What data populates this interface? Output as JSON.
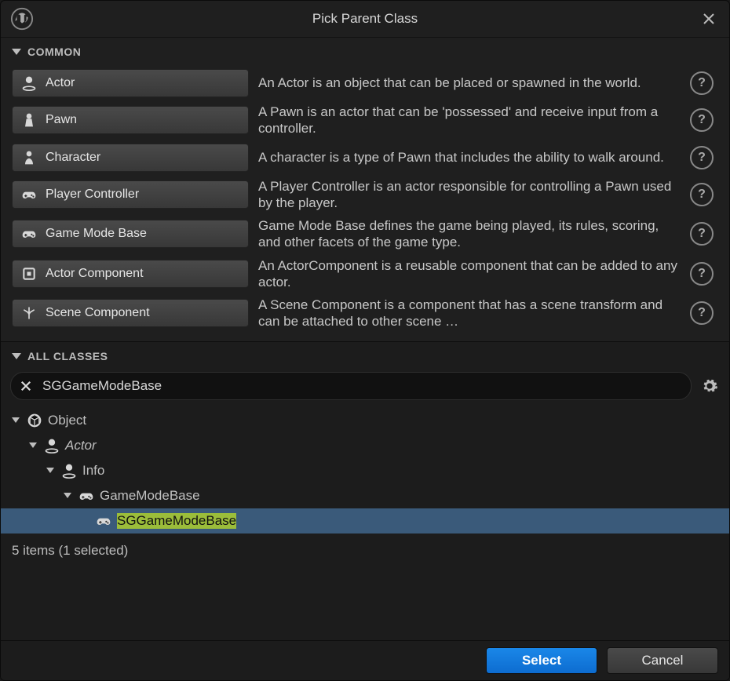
{
  "window": {
    "title": "Pick Parent Class"
  },
  "sections": {
    "common": "COMMON",
    "all": "ALL CLASSES"
  },
  "common_classes": [
    {
      "name": "Actor",
      "icon": "actor-icon",
      "desc": "An Actor is an object that can be placed or spawned in the world."
    },
    {
      "name": "Pawn",
      "icon": "pawn-icon",
      "desc": "A Pawn is an actor that can be 'possessed' and receive input from a controller."
    },
    {
      "name": "Character",
      "icon": "character-icon",
      "desc": "A character is a type of Pawn that includes the ability to walk around."
    },
    {
      "name": "Player Controller",
      "icon": "player-controller-icon",
      "desc": "A Player Controller is an actor responsible for controlling a Pawn used by the player."
    },
    {
      "name": "Game Mode Base",
      "icon": "game-mode-base-icon",
      "desc": "Game Mode Base defines the game being played, its rules, scoring, and other facets of the game type."
    },
    {
      "name": "Actor Component",
      "icon": "actor-component-icon",
      "desc": "An ActorComponent is a reusable component that can be added to any actor."
    },
    {
      "name": "Scene Component",
      "icon": "scene-component-icon",
      "desc": "A Scene Component is a component that has a scene transform and can be attached to other scene …"
    }
  ],
  "search": {
    "value": "SGGameModeBase"
  },
  "tree": {
    "nodes": [
      {
        "depth": 0,
        "label": "Object",
        "icon": "object-icon",
        "italic": false,
        "selected": false,
        "expander": true
      },
      {
        "depth": 1,
        "label": "Actor",
        "icon": "actor-icon",
        "italic": true,
        "selected": false,
        "expander": true
      },
      {
        "depth": 2,
        "label": "Info",
        "icon": "actor-icon",
        "italic": false,
        "selected": false,
        "expander": true
      },
      {
        "depth": 3,
        "label": "GameModeBase",
        "icon": "gamemode-icon",
        "italic": false,
        "selected": false,
        "expander": true
      },
      {
        "depth": 4,
        "label": "SGGameModeBase",
        "icon": "gamemode-icon",
        "italic": false,
        "selected": true,
        "expander": false,
        "highlight": true
      }
    ]
  },
  "status": "5 items (1 selected)",
  "footer": {
    "select": "Select",
    "cancel": "Cancel"
  }
}
